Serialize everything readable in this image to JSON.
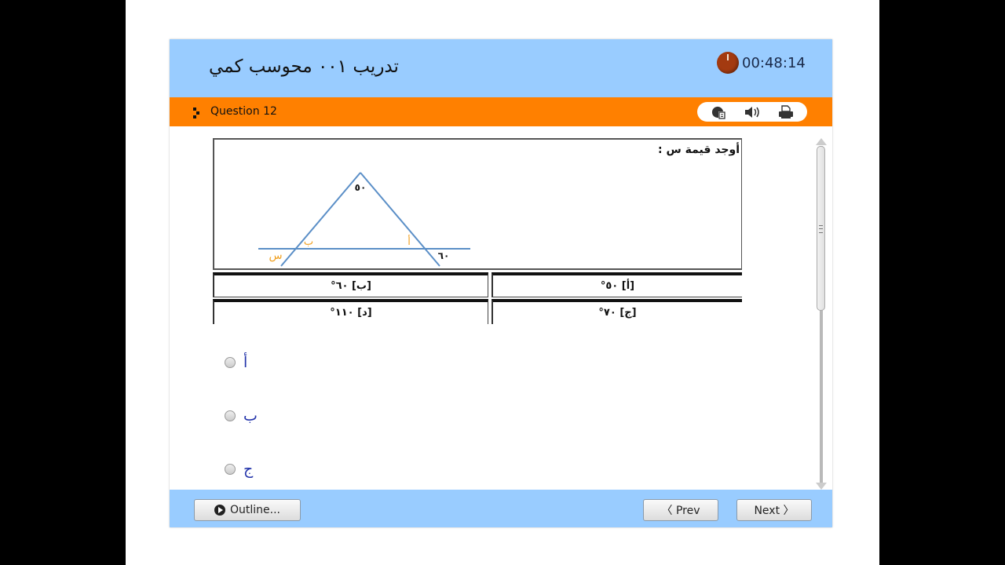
{
  "header": {
    "title": "تدريب ٠٠١ محوسب كمي",
    "timer": "00:48:14"
  },
  "question_bar": {
    "label": "Question 12",
    "tools": [
      {
        "icon": "reference-icon"
      },
      {
        "icon": "audio-icon"
      },
      {
        "icon": "print-icon"
      }
    ]
  },
  "question": {
    "prompt": "أوجد قيمة س :",
    "diagram": {
      "apex_angle": "٥٠",
      "exterior_angle": "٦٠",
      "label_a": "أ",
      "label_b": "ب",
      "label_x": "س",
      "line_color": "#5b8fc7",
      "label_color": "#f0a020"
    },
    "choices_table": [
      {
        "key": "[أ]",
        "value": "٥٠°"
      },
      {
        "key": "[ب]",
        "value": "٦٠°"
      },
      {
        "key": "[ج]",
        "value": "٧٠°"
      },
      {
        "key": "[د]",
        "value": "١١٠°"
      }
    ]
  },
  "answers": [
    {
      "label": "أ",
      "selected": false
    },
    {
      "label": "ب",
      "selected": false
    },
    {
      "label": "ج",
      "selected": false
    }
  ],
  "footer": {
    "outline_label": "Outline...",
    "prev_label": "〈 Prev",
    "next_label": "Next 〉"
  },
  "colors": {
    "header_bg": "#99ccff",
    "question_bar_bg": "#ff8000",
    "answer_text": "#2233aa"
  }
}
